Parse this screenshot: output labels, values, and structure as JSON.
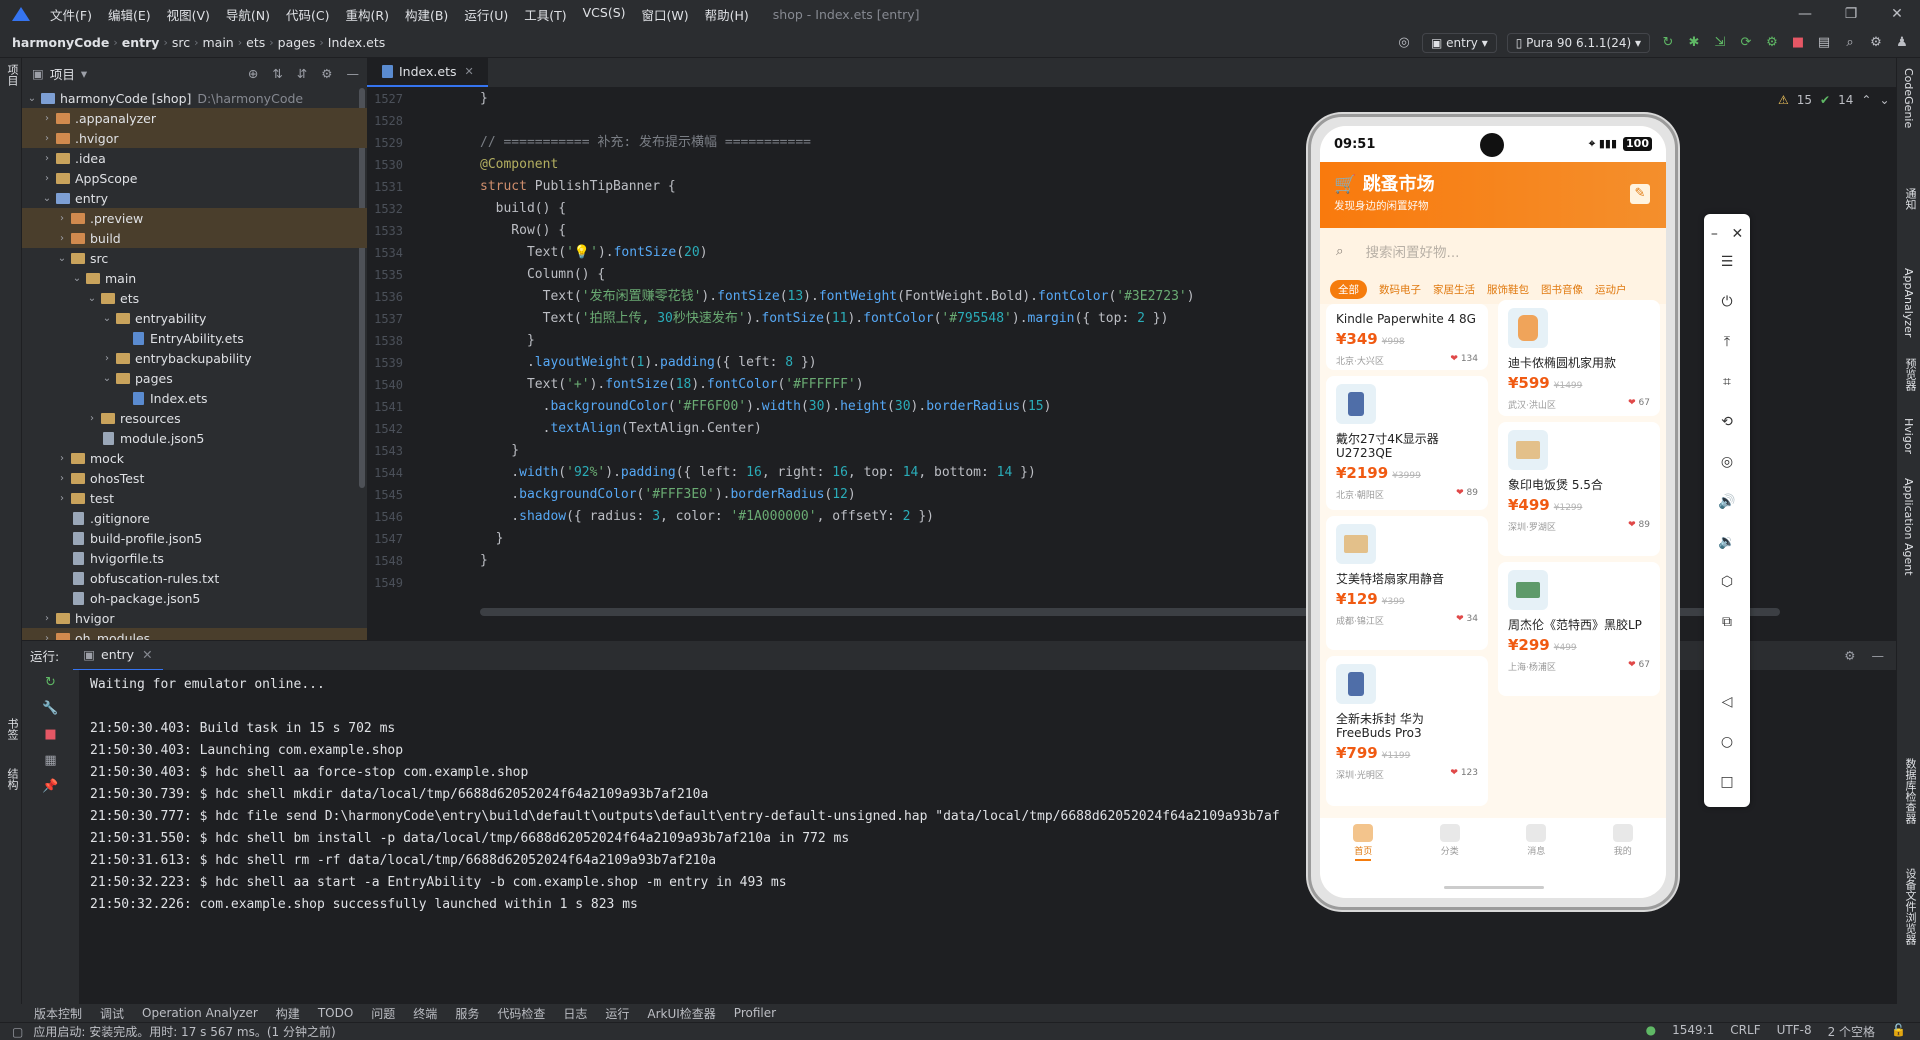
{
  "menu": {
    "items": [
      "文件(F)",
      "编辑(E)",
      "视图(V)",
      "导航(N)",
      "代码(C)",
      "重构(R)",
      "构建(B)",
      "运行(U)",
      "工具(T)",
      "VCS(S)",
      "窗口(W)",
      "帮助(H)"
    ],
    "window_title": "shop - Index.ets [entry]"
  },
  "breadcrumb": [
    "harmonyCode",
    "entry",
    "src",
    "main",
    "ets",
    "pages",
    "Index.ets"
  ],
  "toolbar": {
    "module": "entry",
    "device": "Pura 90 6.1.1(24)"
  },
  "left_strip": {
    "project": "项目",
    "bookmarks": "书签",
    "structure": "结构"
  },
  "project_panel": {
    "title": "项目"
  },
  "tree": [
    {
      "label": "harmonyCode [shop]",
      "extra": "D:\\harmonyCode",
      "depth": 0,
      "type": "folder-blue",
      "open": true
    },
    {
      "label": ".appanalyzer",
      "depth": 1,
      "type": "folder-orange",
      "open": false,
      "hl": true
    },
    {
      "label": ".hvigor",
      "depth": 1,
      "type": "folder-orange",
      "open": false,
      "hl": true
    },
    {
      "label": ".idea",
      "depth": 1,
      "type": "folder",
      "open": false
    },
    {
      "label": "AppScope",
      "depth": 1,
      "type": "folder",
      "open": false
    },
    {
      "label": "entry",
      "depth": 1,
      "type": "folder-blue",
      "open": true
    },
    {
      "label": ".preview",
      "depth": 2,
      "type": "folder-orange",
      "open": false,
      "hl": true
    },
    {
      "label": "build",
      "depth": 2,
      "type": "folder-orange",
      "open": false,
      "hl": true
    },
    {
      "label": "src",
      "depth": 2,
      "type": "folder",
      "open": true
    },
    {
      "label": "main",
      "depth": 3,
      "type": "folder",
      "open": true
    },
    {
      "label": "ets",
      "depth": 4,
      "type": "folder",
      "open": true
    },
    {
      "label": "entryability",
      "depth": 5,
      "type": "folder",
      "open": true
    },
    {
      "label": "EntryAbility.ets",
      "depth": 6,
      "type": "file-ets"
    },
    {
      "label": "entrybackupability",
      "depth": 5,
      "type": "folder",
      "open": false
    },
    {
      "label": "pages",
      "depth": 5,
      "type": "folder",
      "open": true
    },
    {
      "label": "Index.ets",
      "depth": 6,
      "type": "file-ets"
    },
    {
      "label": "resources",
      "depth": 4,
      "type": "folder",
      "open": false
    },
    {
      "label": "module.json5",
      "depth": 4,
      "type": "file"
    },
    {
      "label": "mock",
      "depth": 2,
      "type": "folder",
      "open": false
    },
    {
      "label": "ohosTest",
      "depth": 2,
      "type": "folder",
      "open": false
    },
    {
      "label": "test",
      "depth": 2,
      "type": "folder",
      "open": false
    },
    {
      "label": ".gitignore",
      "depth": 2,
      "type": "file"
    },
    {
      "label": "build-profile.json5",
      "depth": 2,
      "type": "file"
    },
    {
      "label": "hvigorfile.ts",
      "depth": 2,
      "type": "file"
    },
    {
      "label": "obfuscation-rules.txt",
      "depth": 2,
      "type": "file"
    },
    {
      "label": "oh-package.json5",
      "depth": 2,
      "type": "file"
    },
    {
      "label": "hvigor",
      "depth": 1,
      "type": "folder",
      "open": false
    },
    {
      "label": "oh_modules",
      "depth": 1,
      "type": "folder-orange",
      "open": false,
      "hl": true
    }
  ],
  "editor": {
    "tab": "Index.ets",
    "inspections": {
      "warnings": "15",
      "ok": "14"
    },
    "lines": [
      {
        "n": "1527",
        "code": "}"
      },
      {
        "n": "1528",
        "code": ""
      },
      {
        "n": "1529",
        "code": "// =========== 补充: 发布提示横幅 ==========="
      },
      {
        "n": "1530",
        "code": "@Component"
      },
      {
        "n": "1531",
        "code": "struct PublishTipBanner {"
      },
      {
        "n": "1532",
        "code": "  build() {"
      },
      {
        "n": "1533",
        "code": "    Row() {"
      },
      {
        "n": "1534",
        "code": "      Text('💡').fontSize(20)"
      },
      {
        "n": "1535",
        "code": "      Column() {"
      },
      {
        "n": "1536",
        "code": "        Text('发布闲置赚零花钱').fontSize(13).fontWeight(FontWeight.Bold).fontColor('#3E2723')"
      },
      {
        "n": "1537",
        "code": "        Text('拍照上传, 30秒快速发布').fontSize(11).fontColor('#795548').margin({ top: 2 })"
      },
      {
        "n": "1538",
        "code": "      }"
      },
      {
        "n": "1539",
        "code": "      .layoutWeight(1).padding({ left: 8 })"
      },
      {
        "n": "1540",
        "code": "      Text('+').fontSize(18).fontColor('#FFFFFF')"
      },
      {
        "n": "1541",
        "code": "        .backgroundColor('#FF6F00').width(30).height(30).borderRadius(15)"
      },
      {
        "n": "1542",
        "code": "        .textAlign(TextAlign.Center)"
      },
      {
        "n": "1543",
        "code": "    }"
      },
      {
        "n": "1544",
        "code": "    .width('92%').padding({ left: 16, right: 16, top: 14, bottom: 14 })"
      },
      {
        "n": "1545",
        "code": "    .backgroundColor('#FFF3E0').borderRadius(12)"
      },
      {
        "n": "1546",
        "code": "    .shadow({ radius: 3, color: '#1A000000', offsetY: 2 })"
      },
      {
        "n": "1547",
        "code": "  }"
      },
      {
        "n": "1548",
        "code": "}"
      },
      {
        "n": "1549",
        "code": ""
      }
    ]
  },
  "run_panel": {
    "label": "运行:",
    "tab": "entry",
    "lines": [
      "Waiting for emulator online...",
      "",
      "21:50:30.403: Build task in 15 s 702 ms",
      "21:50:30.403: Launching com.example.shop",
      "21:50:30.403: $ hdc shell aa force-stop com.example.shop",
      "21:50:30.739: $ hdc shell mkdir data/local/tmp/6688d62052024f64a2109a93b7af210a",
      "21:50:30.777: $ hdc file send D:\\harmonyCode\\entry\\build\\default\\outputs\\default\\entry-default-unsigned.hap \"data/local/tmp/6688d62052024f64a2109a93b7af",
      "21:50:31.550: $ hdc shell bm install -p data/local/tmp/6688d62052024f64a2109a93b7af210a in 772 ms",
      "21:50:31.613: $ hdc shell rm -rf data/local/tmp/6688d62052024f64a2109a93b7af210a",
      "21:50:32.223: $ hdc shell aa start -a EntryAbility -b com.example.shop -m entry in 493 ms",
      "21:50:32.226: com.example.shop successfully launched within 1 s 823 ms"
    ]
  },
  "bottom_tools": [
    "版本控制",
    "调试",
    "Operation Analyzer",
    "构建",
    "TODO",
    "问题",
    "终端",
    "服务",
    "代码检查",
    "日志",
    "运行",
    "ArkUI检查器",
    "Profiler"
  ],
  "status": {
    "message": "应用启动: 安装完成。用时: 17 s 567 ms。(1 分钟之前)",
    "position": "1549:1",
    "line_sep": "CRLF",
    "encoding": "UTF-8",
    "indent": "2 个空格"
  },
  "right_strip": [
    "CodeGenie",
    "通知",
    "AppAnalyzer",
    "预览器",
    "Hvigor",
    "Application Agent",
    "数据库检查器",
    "设备文件浏览器"
  ],
  "phone": {
    "time": "09:51",
    "battery": "100",
    "app_title": "跳蚤市场",
    "app_subtitle": "发现身边的闲置好物",
    "search_placeholder": "搜索闲置好物...",
    "categories": [
      "全部",
      "数码电子",
      "家居生活",
      "服饰鞋包",
      "图书音像",
      "运动户"
    ],
    "products": [
      {
        "title": "Kindle Paperwhite 4 8G",
        "price": "¥349",
        "orig": "¥998",
        "loc": "北京·大兴区",
        "likes": "134",
        "thumb": ""
      },
      {
        "title": "迪卡侬椭圆机家用款",
        "price": "¥599",
        "orig": "¥1499",
        "loc": "武汉·洪山区",
        "likes": "67",
        "thumb": "ell"
      },
      {
        "title": "戴尔27寸4K显示器 U2723QE",
        "price": "¥2199",
        "orig": "¥3999",
        "loc": "北京·朝阳区",
        "likes": "89",
        "thumb": "phone"
      },
      {
        "title": "象印电饭煲 5.5合",
        "price": "¥499",
        "orig": "¥1299",
        "loc": "深圳·罗湖区",
        "likes": "89",
        "thumb": "house"
      },
      {
        "title": "艾美特塔扇家用静音",
        "price": "¥129",
        "orig": "¥399",
        "loc": "成都·锦江区",
        "likes": "34",
        "thumb": "house"
      },
      {
        "title": "周杰伦《范特西》黑胶LP",
        "price": "¥299",
        "orig": "¥499",
        "loc": "上海·杨浦区",
        "likes": "67",
        "thumb": "book"
      },
      {
        "title": "全新未拆封 华为FreeBuds Pro3",
        "price": "¥799",
        "orig": "¥1199",
        "loc": "深圳·光明区",
        "likes": "123",
        "thumb": "phone"
      }
    ],
    "tabs": [
      "首页",
      "分类",
      "消息",
      "我的"
    ]
  }
}
